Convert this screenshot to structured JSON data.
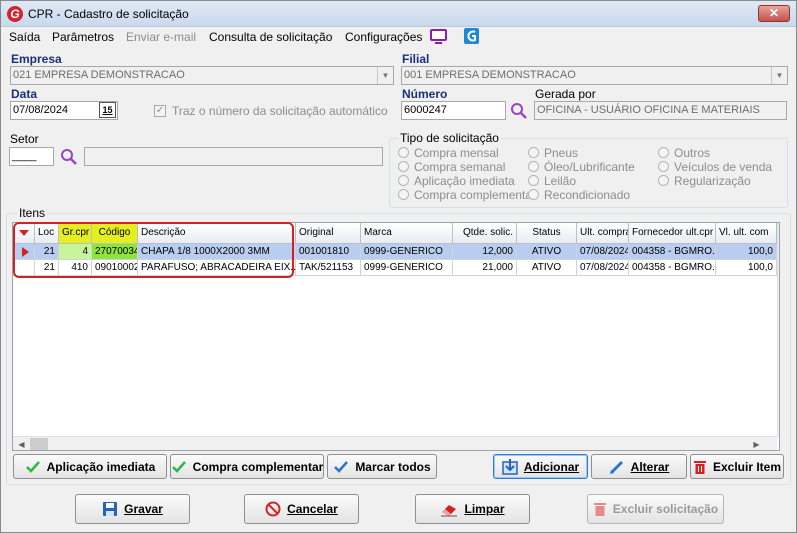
{
  "window": {
    "title": "CPR - Cadastro de solicitação",
    "close_label": "✕",
    "logo_letter": "G"
  },
  "menu": {
    "items": [
      "Saída",
      "Parâmetros",
      "Enviar e-mail",
      "Consulta de solicitação",
      "Configurações"
    ],
    "disabled": [
      "Enviar e-mail"
    ]
  },
  "form": {
    "empresa": {
      "label": "Empresa",
      "value": "021 EMPRESA DEMONSTRACAO"
    },
    "filial": {
      "label": "Filial",
      "value": "001 EMPRESA DEMONSTRACAO"
    },
    "data": {
      "label": "Data",
      "value": "07/08/2024",
      "calendar_label": "15"
    },
    "auto_number": {
      "label": "Traz o número da solicitação automático",
      "checked": true
    },
    "numero": {
      "label": "Número",
      "value": "6000247"
    },
    "gerada_por": {
      "label": "Gerada por",
      "value": "OFICINA - USUÁRIO OFICINA E MATERIAIS"
    },
    "setor": {
      "label": "Setor",
      "value": "____",
      "description": ""
    }
  },
  "tipo_solicitacao": {
    "title": "Tipo de solicitação",
    "col1": [
      "Compra mensal",
      "Compra semanal",
      "Aplicação imediata",
      "Compra complementar"
    ],
    "col2": [
      "Pneus",
      "Óleo/Lubrificante",
      "Leilão",
      "Recondicionado"
    ],
    "col3": [
      "Outros",
      "Veículos de venda",
      "Regularização"
    ]
  },
  "itens": {
    "title": "Itens",
    "columns": [
      "Loc",
      "Gr.cpr",
      "Código",
      "Descrição",
      "Original",
      "Marca",
      "Qtde. solic.",
      "Status",
      "Ult. compra",
      "Fornecedor ult.cpr",
      "Vl. ult. com"
    ],
    "rows": [
      {
        "loc": "21",
        "grcpr": "4",
        "codigo": "27070034",
        "descricao": "CHAPA 1/8 1000X2000 3MM",
        "original": "001001810",
        "marca": "0999-GENERICO",
        "qtde": "12,000",
        "status": "ATIVO",
        "ult_compra": "07/08/2024",
        "fornecedor": "004358 - BGMRO...",
        "vl_ult": "100,0"
      },
      {
        "loc": "21",
        "grcpr": "410",
        "codigo": "09010002",
        "descricao": "PARAFUSO; ABRACADEIRA EIX...",
        "original": "TAK/521153",
        "marca": "0999-GENERICO",
        "qtde": "21,000",
        "status": "ATIVO",
        "ult_compra": "07/08/2024",
        "fornecedor": "004358 - BGMRO...",
        "vl_ult": "100,0"
      }
    ]
  },
  "item_buttons": {
    "aplicacao": "Aplicação imediata",
    "complementar": "Compra complementar",
    "marcar": "Marcar todos",
    "adicionar": "Adicionar",
    "alterar": "Alterar",
    "excluir_item": "Excluir Item"
  },
  "footer_buttons": {
    "gravar": "Gravar",
    "cancelar": "Cancelar",
    "limpar": "Limpar",
    "excluir_solicitacao": "Excluir solicitação"
  },
  "colors": {
    "accent_blue": "#1c2f7a",
    "highlight_red": "#d42222",
    "yellow_header": "#e5ef1d",
    "green_cell": "#8ee43d",
    "selected_row": "#b8cdf0"
  }
}
